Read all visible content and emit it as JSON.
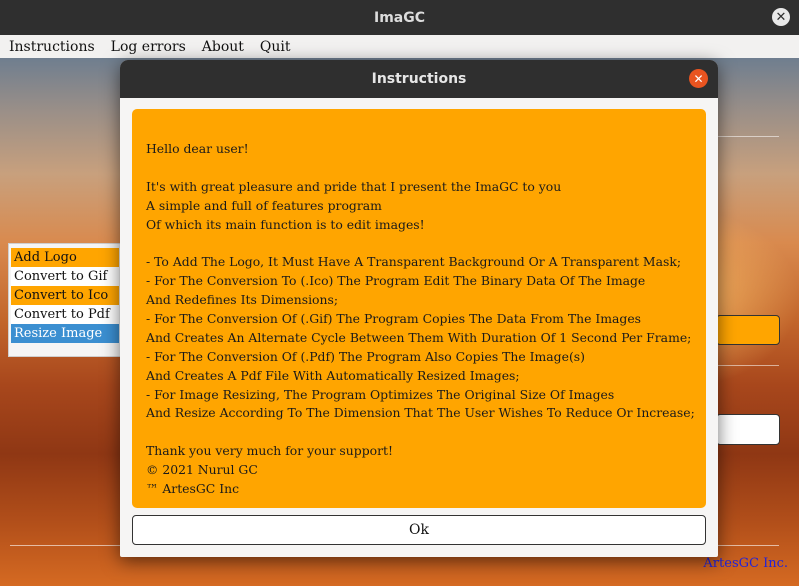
{
  "window": {
    "title": "ImaGC"
  },
  "menu": [
    "Instructions",
    "Log errors",
    "About",
    "Quit"
  ],
  "sidebar": {
    "items": [
      {
        "label": "Add Logo",
        "style": "orange"
      },
      {
        "label": "Convert to Gif",
        "style": "white"
      },
      {
        "label": "Convert to Ico",
        "style": "orange"
      },
      {
        "label": "Convert to Pdf",
        "style": "white"
      },
      {
        "label": "Resize Image",
        "style": "blue",
        "selected": true
      }
    ]
  },
  "brand": "ArtesGC Inc.",
  "dialog": {
    "title": "Instructions",
    "lines": [
      "Hello dear user!",
      "",
      "It's with great pleasure and pride that I present the ImaGC to you",
      "A simple and full of features program",
      "Of which its main function is to edit images!",
      "",
      "- To Add The Logo, It Must Have A Transparent Background Or A Transparent Mask;",
      "- For The Conversion To (.Ico) The Program Edit The Binary Data Of The Image",
      "And Redefines Its Dimensions;",
      "- For The Conversion Of (.Gif) The Program Copies The Data From The Images",
      "And Creates An Alternate Cycle Between Them With Duration Of 1 Second Per Frame;",
      "- For The Conversion Of (.Pdf) The Program Also Copies The Image(s)",
      "And Creates A Pdf File With Automatically Resized Images;",
      "- For Image Resizing, The Program Optimizes The Original Size Of Images",
      "And Resize According To The Dimension That The User Wishes To Reduce Or Increase;",
      "",
      "Thank you very much for your support!",
      "© 2021 Nurul GC",
      "™ ArtesGC Inc"
    ],
    "ok_label": "Ok"
  },
  "colors": {
    "accent": "#ffa500",
    "selected": "#3b8fd1",
    "close": "#e95420",
    "brand": "#2323d8"
  },
  "icons": {
    "window_close": "close-icon",
    "dialog_close": "close-icon"
  }
}
